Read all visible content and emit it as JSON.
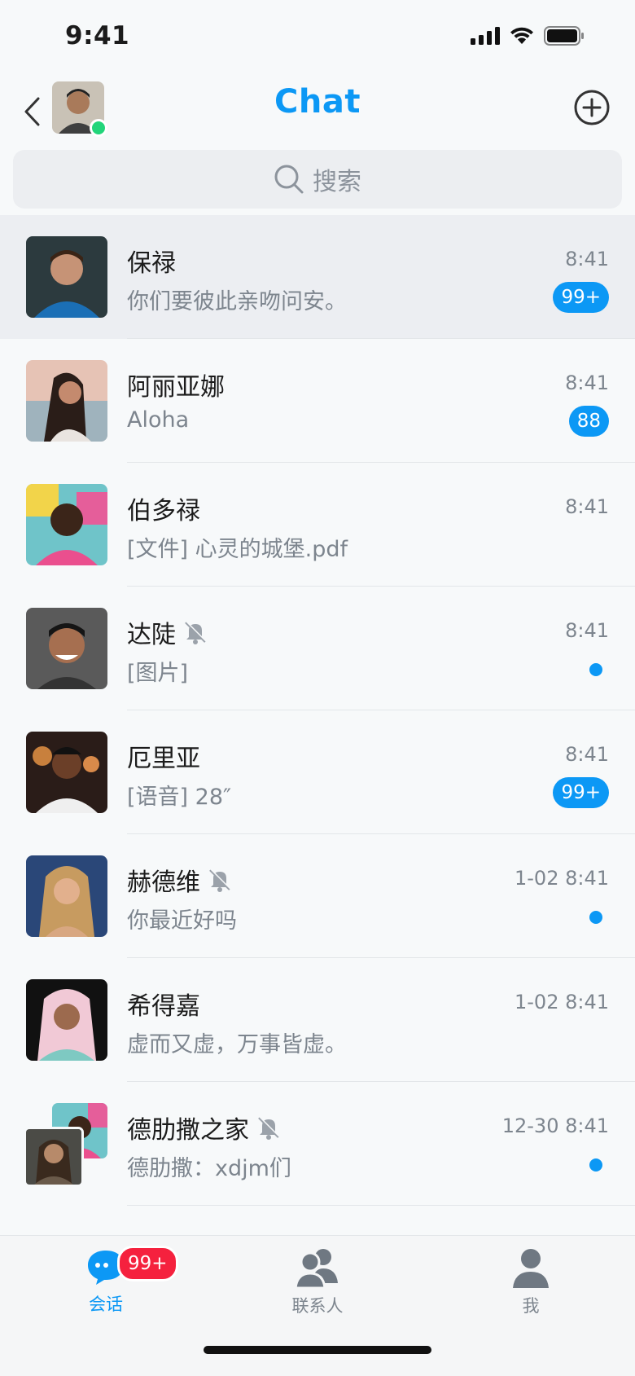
{
  "status_bar": {
    "time": "9:41"
  },
  "nav": {
    "title": "Chat"
  },
  "search": {
    "placeholder": "搜索"
  },
  "chats": [
    {
      "name": "保禄",
      "preview": "你们要彼此亲吻问安。",
      "time": "8:41",
      "badge": "99+",
      "muted": false,
      "active": true
    },
    {
      "name": "阿丽亚娜",
      "preview": "Aloha",
      "time": "8:41",
      "badge": "88",
      "muted": false
    },
    {
      "name": "伯多禄",
      "preview": "[文件] 心灵的城堡.pdf",
      "time": "8:41",
      "badge": "",
      "muted": false
    },
    {
      "name": "达陡",
      "preview": "[图片]",
      "time": "8:41",
      "badge": "",
      "dot": true,
      "muted": true
    },
    {
      "name": "厄里亚",
      "preview": "[语音] 28″",
      "time": "8:41",
      "badge": "99+",
      "muted": false
    },
    {
      "name": "赫德维",
      "preview": "你最近好吗",
      "time": "1-02 8:41",
      "badge": "",
      "dot": true,
      "muted": true
    },
    {
      "name": "希得嘉",
      "preview": "虚而又虚，万事皆虚。",
      "time": "1-02 8:41",
      "badge": "",
      "muted": false
    },
    {
      "name": "德肋撒之家",
      "preview": "德肋撒：xdjm们",
      "time": "12-30 8:41",
      "badge": "",
      "dot": true,
      "muted": true
    }
  ],
  "tabs": [
    {
      "label": "会话",
      "badge": "99+",
      "active": true
    },
    {
      "label": "联系人"
    },
    {
      "label": "我"
    }
  ],
  "colors": {
    "accent": "#0c98f5",
    "badge_red": "#f5213e",
    "online": "#22d57a"
  }
}
